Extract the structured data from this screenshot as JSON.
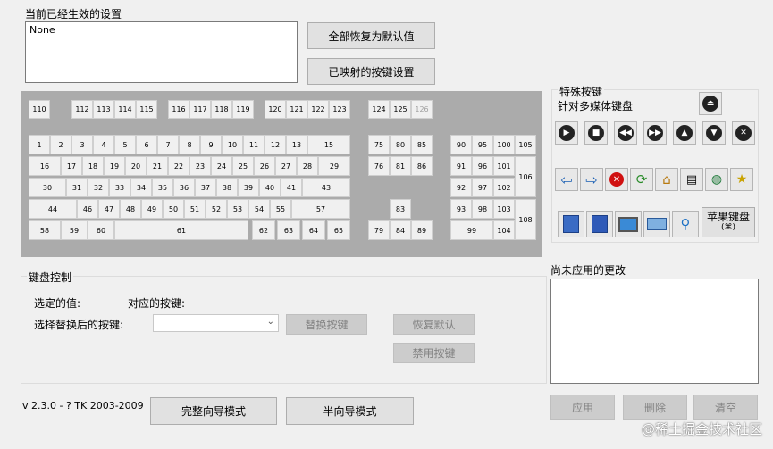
{
  "current_settings": {
    "label": "当前已经生效的设置",
    "value": "None"
  },
  "buttons": {
    "restore_all": "全部恢复为默认值",
    "mapped_keys": "已映射的按键设置"
  },
  "keyboard": {
    "keys": [
      {
        "id": "110",
        "label": "110"
      },
      {
        "id": "112",
        "label": "112"
      },
      {
        "id": "113",
        "label": "113"
      },
      {
        "id": "114",
        "label": "114"
      },
      {
        "id": "115",
        "label": "115"
      },
      {
        "id": "116",
        "label": "116"
      },
      {
        "id": "117",
        "label": "117"
      },
      {
        "id": "118",
        "label": "118"
      },
      {
        "id": "119",
        "label": "119"
      },
      {
        "id": "120",
        "label": "120"
      },
      {
        "id": "121",
        "label": "121"
      },
      {
        "id": "122",
        "label": "122"
      },
      {
        "id": "123",
        "label": "123"
      },
      {
        "id": "124",
        "label": "124"
      },
      {
        "id": "125",
        "label": "125"
      },
      {
        "id": "126",
        "label": "126"
      },
      {
        "id": "1",
        "label": "1"
      },
      {
        "id": "2",
        "label": "2"
      },
      {
        "id": "3",
        "label": "3"
      },
      {
        "id": "4",
        "label": "4"
      },
      {
        "id": "5",
        "label": "5"
      },
      {
        "id": "6",
        "label": "6"
      },
      {
        "id": "7",
        "label": "7"
      },
      {
        "id": "8",
        "label": "8"
      },
      {
        "id": "9",
        "label": "9"
      },
      {
        "id": "10",
        "label": "10"
      },
      {
        "id": "11",
        "label": "11"
      },
      {
        "id": "12",
        "label": "12"
      },
      {
        "id": "13",
        "label": "13"
      },
      {
        "id": "15",
        "label": "15"
      },
      {
        "id": "75",
        "label": "75"
      },
      {
        "id": "80",
        "label": "80"
      },
      {
        "id": "85",
        "label": "85"
      },
      {
        "id": "90",
        "label": "90"
      },
      {
        "id": "95",
        "label": "95"
      },
      {
        "id": "100",
        "label": "100"
      },
      {
        "id": "105",
        "label": "105"
      },
      {
        "id": "16",
        "label": "16"
      },
      {
        "id": "17",
        "label": "17"
      },
      {
        "id": "18",
        "label": "18"
      },
      {
        "id": "19",
        "label": "19"
      },
      {
        "id": "20",
        "label": "20"
      },
      {
        "id": "21",
        "label": "21"
      },
      {
        "id": "22",
        "label": "22"
      },
      {
        "id": "23",
        "label": "23"
      },
      {
        "id": "24",
        "label": "24"
      },
      {
        "id": "25",
        "label": "25"
      },
      {
        "id": "26",
        "label": "26"
      },
      {
        "id": "27",
        "label": "27"
      },
      {
        "id": "28",
        "label": "28"
      },
      {
        "id": "29",
        "label": "29"
      },
      {
        "id": "76",
        "label": "76"
      },
      {
        "id": "81",
        "label": "81"
      },
      {
        "id": "86",
        "label": "86"
      },
      {
        "id": "91",
        "label": "91"
      },
      {
        "id": "96",
        "label": "96"
      },
      {
        "id": "101",
        "label": "101"
      },
      {
        "id": "106",
        "label": "106"
      },
      {
        "id": "30",
        "label": "30"
      },
      {
        "id": "31",
        "label": "31"
      },
      {
        "id": "32",
        "label": "32"
      },
      {
        "id": "33",
        "label": "33"
      },
      {
        "id": "34",
        "label": "34"
      },
      {
        "id": "35",
        "label": "35"
      },
      {
        "id": "36",
        "label": "36"
      },
      {
        "id": "37",
        "label": "37"
      },
      {
        "id": "38",
        "label": "38"
      },
      {
        "id": "39",
        "label": "39"
      },
      {
        "id": "40",
        "label": "40"
      },
      {
        "id": "41",
        "label": "41"
      },
      {
        "id": "43",
        "label": "43"
      },
      {
        "id": "92",
        "label": "92"
      },
      {
        "id": "97",
        "label": "97"
      },
      {
        "id": "102",
        "label": "102"
      },
      {
        "id": "44",
        "label": "44"
      },
      {
        "id": "46",
        "label": "46"
      },
      {
        "id": "47",
        "label": "47"
      },
      {
        "id": "48",
        "label": "48"
      },
      {
        "id": "49",
        "label": "49"
      },
      {
        "id": "50",
        "label": "50"
      },
      {
        "id": "51",
        "label": "51"
      },
      {
        "id": "52",
        "label": "52"
      },
      {
        "id": "53",
        "label": "53"
      },
      {
        "id": "54",
        "label": "54"
      },
      {
        "id": "55",
        "label": "55"
      },
      {
        "id": "57",
        "label": "57"
      },
      {
        "id": "83",
        "label": "83"
      },
      {
        "id": "93",
        "label": "93"
      },
      {
        "id": "98",
        "label": "98"
      },
      {
        "id": "103",
        "label": "103"
      },
      {
        "id": "108",
        "label": "108"
      },
      {
        "id": "58",
        "label": "58"
      },
      {
        "id": "59",
        "label": "59"
      },
      {
        "id": "60",
        "label": "60"
      },
      {
        "id": "61",
        "label": "61"
      },
      {
        "id": "62",
        "label": "62"
      },
      {
        "id": "63",
        "label": "63"
      },
      {
        "id": "64",
        "label": "64"
      },
      {
        "id": "65",
        "label": "65"
      },
      {
        "id": "79",
        "label": "79"
      },
      {
        "id": "84",
        "label": "84"
      },
      {
        "id": "89",
        "label": "89"
      },
      {
        "id": "99",
        "label": "99"
      },
      {
        "id": "104",
        "label": "104"
      }
    ]
  },
  "special": {
    "title": "特殊按键",
    "subtitle": "针对多媒体键盘",
    "apple_label": "苹果键盘",
    "apple_sub": "(⌘)",
    "icons": [
      "eject-icon",
      "play-icon",
      "stop-icon",
      "prev-track-icon",
      "next-track-icon",
      "volume-up-icon",
      "volume-down-icon",
      "mute-icon",
      "back-arrow-icon",
      "forward-arrow-icon",
      "stop-red-icon",
      "refresh-icon",
      "home-icon",
      "search-doc-icon",
      "web-icon",
      "favorites-icon",
      "my-computer-icon",
      "media-icon",
      "computer-icon",
      "calculator-icon",
      "search-icon"
    ]
  },
  "kb_control": {
    "title": "键盘控制",
    "selected_value_label": "选定的值:",
    "mapped_key_label": "对应的按键:",
    "replace_after_label": "选择替换后的按键:",
    "replace_btn": "替换按键",
    "restore_btn": "恢复默认",
    "disable_btn": "禁用按键"
  },
  "pending": {
    "title": "尚未应用的更改",
    "apply": "应用",
    "delete": "删除",
    "clear": "清空"
  },
  "footer": {
    "version": "v 2.3.0 - ? TK 2003-2009",
    "full_wizard": "完整向导模式",
    "half_wizard": "半向导模式"
  },
  "watermark": "@稀土掘金技术社区"
}
